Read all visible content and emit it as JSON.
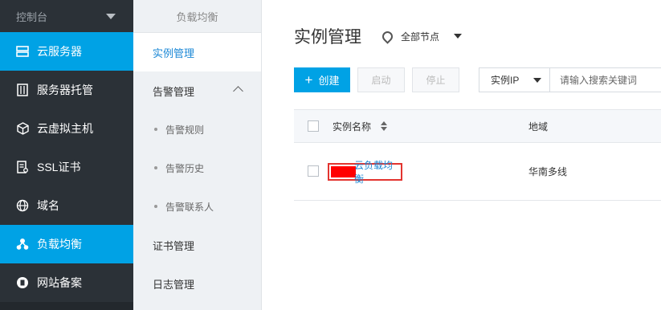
{
  "sidebar": {
    "header": "控制台",
    "items": [
      {
        "label": "云服务器",
        "icon": "server-icon",
        "active": true
      },
      {
        "label": "服务器托管",
        "icon": "rack-icon",
        "active": false
      },
      {
        "label": "云虚拟主机",
        "icon": "cube-icon",
        "active": false
      },
      {
        "label": "SSL证书",
        "icon": "certificate-icon",
        "active": false
      },
      {
        "label": "域名",
        "icon": "globe-icon",
        "active": false
      },
      {
        "label": "负载均衡",
        "icon": "load-balancer-icon",
        "active": true
      },
      {
        "label": "网站备案",
        "icon": "record-icon",
        "active": false
      }
    ]
  },
  "subnav": {
    "title": "负载均衡",
    "instance": "实例管理",
    "alarm": "告警管理",
    "alarm_children": [
      "告警规则",
      "告警历史",
      "告警联系人"
    ],
    "cert": "证书管理",
    "log": "日志管理"
  },
  "main": {
    "title": "实例管理",
    "location": "全部节点",
    "toolbar": {
      "create": "创建",
      "start": "启动",
      "stop": "停止",
      "filter_select": "实例IP",
      "search_placeholder": "请输入搜索关键词"
    },
    "table": {
      "headers": [
        "实例名称",
        "地域"
      ],
      "rows": [
        {
          "name": "云负载均衡",
          "region": "华南多线"
        }
      ]
    }
  },
  "colors": {
    "accent": "#00a2e5",
    "sidebar_bg": "#2b3137",
    "link": "#1b88d6",
    "highlight": "#e3342f"
  }
}
